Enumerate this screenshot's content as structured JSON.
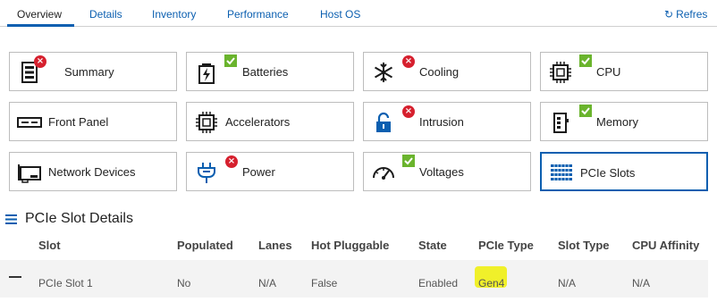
{
  "tabs": [
    {
      "label": "Overview",
      "active": true
    },
    {
      "label": "Details"
    },
    {
      "label": "Inventory"
    },
    {
      "label": "Performance"
    },
    {
      "label": "Host OS"
    }
  ],
  "refresh_label": "Refres",
  "tiles": [
    {
      "label": "Summary",
      "icon": "summary-icon",
      "status": "error"
    },
    {
      "label": "Batteries",
      "icon": "battery-icon",
      "status": "ok"
    },
    {
      "label": "Cooling",
      "icon": "snowflake-icon",
      "status": "error"
    },
    {
      "label": "CPU",
      "icon": "cpu-icon",
      "status": "ok"
    },
    {
      "label": "Front Panel",
      "icon": "front-panel-icon",
      "status": "none"
    },
    {
      "label": "Accelerators",
      "icon": "accelerator-chip-icon",
      "status": "none"
    },
    {
      "label": "Intrusion",
      "icon": "padlock-icon",
      "status": "error"
    },
    {
      "label": "Memory",
      "icon": "memory-icon",
      "status": "ok"
    },
    {
      "label": "Network Devices",
      "icon": "network-card-icon",
      "status": "none"
    },
    {
      "label": "Power",
      "icon": "power-plug-icon",
      "status": "error"
    },
    {
      "label": "Voltages",
      "icon": "gauge-icon",
      "status": "ok"
    },
    {
      "label": "PCIe Slots",
      "icon": "pcie-slots-icon",
      "status": "none",
      "selected": true
    }
  ],
  "details": {
    "title": "PCIe Slot Details",
    "columns": [
      "Slot",
      "Populated",
      "Lanes",
      "Hot Pluggable",
      "State",
      "PCIe Type",
      "Slot Type",
      "CPU Affinity"
    ],
    "rows": [
      {
        "slot": "PCIe Slot 1",
        "populated": "No",
        "lanes": "N/A",
        "hot_pluggable": "False",
        "state": "Enabled",
        "pcie_type": "Gen4",
        "slot_type": "N/A",
        "cpu_affinity": "N/A"
      }
    ]
  },
  "colors": {
    "accent": "#0b5fb0",
    "error": "#d6202e",
    "ok": "#6ab42d",
    "highlight": "#f0f02a"
  }
}
